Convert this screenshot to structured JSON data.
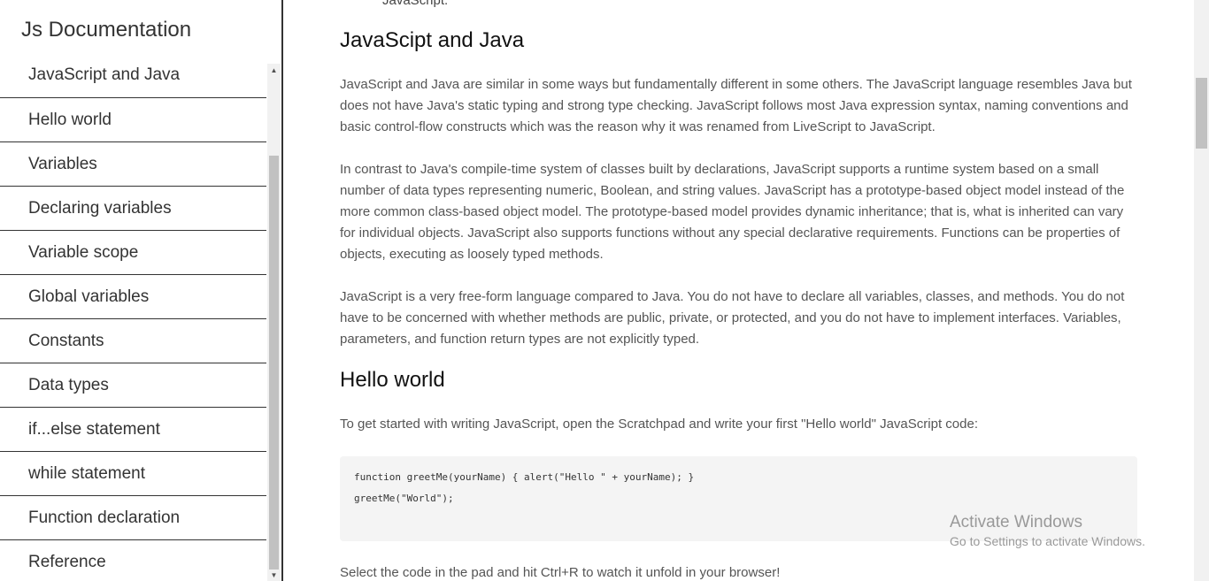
{
  "sidebar": {
    "title": "Js Documentation",
    "items": [
      {
        "label": "JavaScript and Java"
      },
      {
        "label": "Hello world"
      },
      {
        "label": "Variables"
      },
      {
        "label": "Declaring variables"
      },
      {
        "label": "Variable scope"
      },
      {
        "label": "Global variables"
      },
      {
        "label": "Constants"
      },
      {
        "label": "Data types"
      },
      {
        "label": "if...else statement"
      },
      {
        "label": "while statement"
      },
      {
        "label": "Function declaration"
      },
      {
        "label": "Reference"
      }
    ]
  },
  "main": {
    "top_cut_text": "JavaScript.",
    "sections": [
      {
        "heading": "JavaScipt and Java",
        "paragraphs": [
          "JavaScript and Java are similar in some ways but fundamentally different in some others. The JavaScript language resembles Java but does not have Java's static typing and strong type checking. JavaScript follows most Java expression syntax, naming conventions and basic control-flow constructs which was the reason why it was renamed from LiveScript to JavaScript.",
          "In contrast to Java's compile-time system of classes built by declarations, JavaScript supports a runtime system based on a small number of data types representing numeric, Boolean, and string values. JavaScript has a prototype-based object model instead of the more common class-based object model. The prototype-based model provides dynamic inheritance; that is, what is inherited can vary for individual objects. JavaScript also supports functions without any special declarative requirements. Functions can be properties of objects, executing as loosely typed methods.",
          "JavaScript is a very free-form language compared to Java. You do not have to declare all variables, classes, and methods. You do not have to be concerned with whether methods are public, private, or protected, and you do not have to implement interfaces. Variables, parameters, and function return types are not explicitly typed."
        ]
      },
      {
        "heading": "Hello world",
        "intro": "To get started with writing JavaScript, open the Scratchpad and write your first \"Hello world\" JavaScript code:",
        "code_lines": [
          "function greetMe(yourName) { alert(\"Hello \" + yourName); }",
          "greetMe(\"World\");"
        ],
        "after_code": "Select the code in the pad and hit Ctrl+R to watch it unfold in your browser!"
      }
    ]
  },
  "watermark": {
    "title": "Activate Windows",
    "subtitle": "Go to Settings to activate Windows."
  },
  "scroll": {
    "up_arrow": "▲",
    "down_arrow": "▼"
  }
}
